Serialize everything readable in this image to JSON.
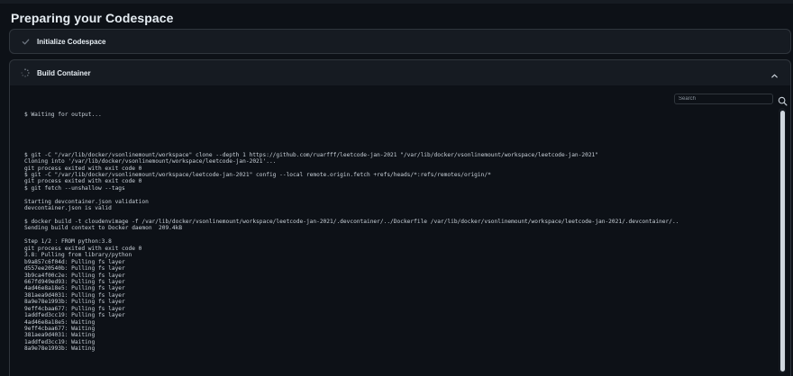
{
  "page": {
    "title": "Preparing your Codespace"
  },
  "steps": {
    "initialize": {
      "label": "Initialize Codespace",
      "status": "complete",
      "icon": "check-icon"
    },
    "build": {
      "label": "Build Container",
      "status": "in-progress",
      "icon": "spinner-icon",
      "expanded": true
    }
  },
  "log": {
    "search_placeholder": "Search",
    "lines": [
      "$ Waiting for output...",
      "",
      "",
      "",
      "",
      "",
      "$ git -C \"/var/lib/docker/vsonlinemount/workspace\" clone --depth 1 https://github.com/ruarfff/leetcode-jan-2021 \"/var/lib/docker/vsonlinemount/workspace/leetcode-jan-2021\"",
      "Cloning into '/var/lib/docker/vsonlinemount/workspace/leetcode-jan-2021'...",
      "git process exited with exit code 0",
      "$ git -C \"/var/lib/docker/vsonlinemount/workspace/leetcode-jan-2021\" config --local remote.origin.fetch +refs/heads/*:refs/remotes/origin/*",
      "git process exited with exit code 0",
      "$ git fetch --unshallow --tags",
      "",
      "Starting devcontainer.json validation",
      "devcontainer.json is valid",
      "",
      "$ docker build -t cloudenvimage -f /var/lib/docker/vsonlinemount/workspace/leetcode-jan-2021/.devcontainer/../Dockerfile /var/lib/docker/vsonlinemount/workspace/leetcode-jan-2021/.devcontainer/..",
      "Sending build context to Docker daemon  209.4kB",
      "",
      "Step 1/2 : FROM python:3.8",
      "git process exited with exit code 0",
      "3.8: Pulling from library/python",
      "b9a857c6f04d: Pulling fs layer",
      "d557ee20540b: Pulling fs layer",
      "3b9ca4f00c2e: Pulling fs layer",
      "667fd949ed93: Pulling fs layer",
      "4ad46e8a18e5: Pulling fs layer",
      "381aea9d4031: Pulling fs layer",
      "8a9e78e1993b: Pulling fs layer",
      "9eff4cbaa677: Pulling fs layer",
      "1addfed3cc19: Pulling fs layer",
      "4ad46e8a18e5: Waiting",
      "9eff4cbaa677: Waiting",
      "381aea9d4031: Waiting",
      "1addfed3cc19: Waiting",
      "8a9e78e1993b: Waiting"
    ]
  },
  "colors": {
    "background": "#0d1117",
    "panel": "#161b22",
    "border": "#30363d",
    "text": "#c9d1d9",
    "heading": "#e6edf3",
    "muted": "#8b949e"
  }
}
